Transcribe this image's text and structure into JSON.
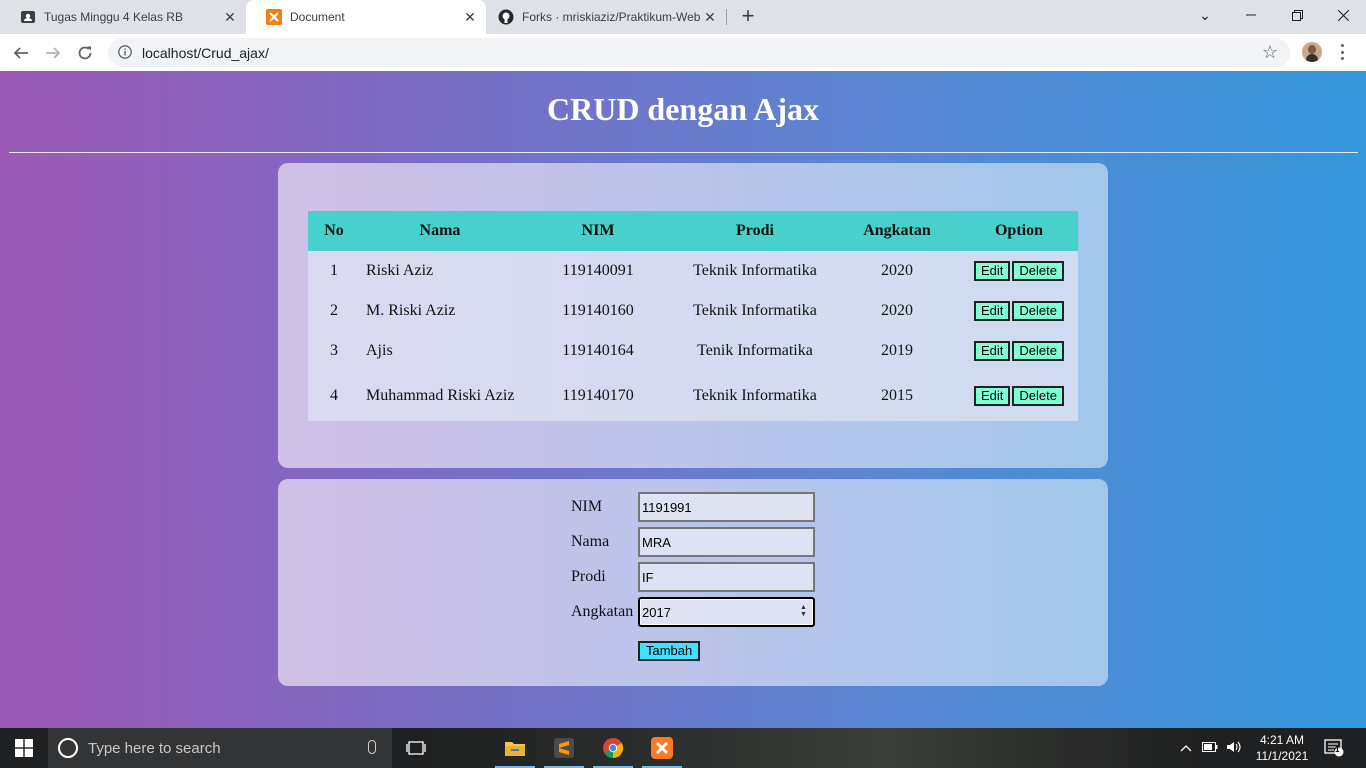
{
  "browser": {
    "tabs": [
      {
        "title": "Tugas Minggu 4 Kelas RB",
        "icon": "classroom-icon",
        "active": false
      },
      {
        "title": "Document",
        "icon": "xampp-icon",
        "active": true
      },
      {
        "title": "Forks · mriskiaziz/Praktikum-Web",
        "icon": "github-icon",
        "active": false
      }
    ],
    "url": "localhost/Crud_ajax/"
  },
  "page": {
    "heading": "CRUD dengan Ajax",
    "table": {
      "headers": [
        "No",
        "Nama",
        "NIM",
        "Prodi",
        "Angkatan",
        "Option"
      ],
      "rows": [
        {
          "no": "1",
          "nama": "Riski Aziz",
          "nim": "119140091",
          "prodi": "Teknik Informatika",
          "angkatan": "2020"
        },
        {
          "no": "2",
          "nama": "M. Riski Aziz",
          "nim": "119140160",
          "prodi": "Teknik Informatika",
          "angkatan": "2020"
        },
        {
          "no": "3",
          "nama": "Ajis",
          "nim": "119140164",
          "prodi": "Tenik Informatika",
          "angkatan": "2019"
        },
        {
          "no": "4",
          "nama": "Muhammad Riski Aziz",
          "nim": "119140170",
          "prodi": "Teknik Informatika",
          "angkatan": "2015"
        }
      ],
      "edit_label": "Edit",
      "delete_label": "Delete"
    },
    "form": {
      "nim_label": "NIM",
      "nim_value": "1191991",
      "nama_label": "Nama",
      "nama_value": "MRA",
      "prodi_label": "Prodi",
      "prodi_value": "IF",
      "angkatan_label": "Angkatan",
      "angkatan_value": "2017",
      "submit_label": "Tambah"
    }
  },
  "taskbar": {
    "search_placeholder": "Type here to search",
    "time": "4:21 AM",
    "date": "11/1/2021",
    "notification_count": "1"
  },
  "colors": {
    "gradient_start": "#9b59b6",
    "gradient_end": "#3498db",
    "table_header": "#48d1cc",
    "action_button": "#7fffd4",
    "submit_button": "#40e0ff"
  }
}
